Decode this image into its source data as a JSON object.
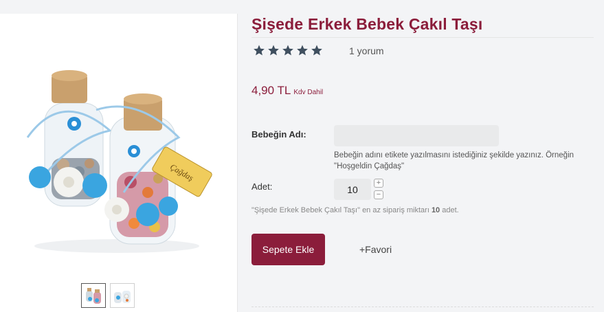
{
  "product": {
    "title": "Şişede Erkek Bebek Çakıl Taşı",
    "rating_stars": 5,
    "review_count": "1 yorum",
    "price": "4,90 TL",
    "price_note": "Kdv Dahil",
    "image_label": "Çağdaş"
  },
  "form": {
    "name_label": "Bebeğin Adı:",
    "name_value": "",
    "name_hint": "Bebeğin adını etikete yazılmasını istediğiniz şekilde yazınız. Örneğin \"Hoşgeldin Çağdaş\"",
    "quantity_label": "Adet:",
    "quantity_value": "10",
    "plus_symbol": "+",
    "minus_symbol": "−",
    "min_order_text": "\"Şişede Erkek Bebek Çakıl Taşı\" en az sipariş miktarı ",
    "min_order_qty": "10",
    "min_order_unit": " adet."
  },
  "actions": {
    "add_to_cart": "Sepete Ekle",
    "favorite": "+Favori"
  },
  "colors": {
    "brand": "#8b1d3b",
    "star": "#3f4f5f",
    "input_bg": "#e9eaeb"
  },
  "icons": {
    "star": "star-icon"
  }
}
